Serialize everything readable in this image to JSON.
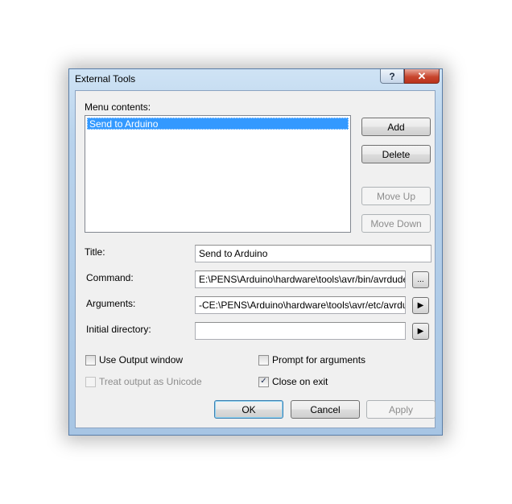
{
  "window": {
    "title": "External Tools",
    "help_label": "?",
    "close_label": "✕"
  },
  "menu": {
    "label": "Menu contents:",
    "items": [
      "Send to Arduino"
    ]
  },
  "buttons": {
    "add": "Add",
    "delete": "Delete",
    "move_up": "Move Up",
    "move_down": "Move Down",
    "ok": "OK",
    "cancel": "Cancel",
    "apply": "Apply"
  },
  "fields": {
    "title_label": "Title:",
    "title_value": "Send to Arduino",
    "command_label": "Command:",
    "command_value": "E:\\PENS\\Arduino\\hardware\\tools\\avr/bin/avrdude",
    "command_browse": "...",
    "arguments_label": "Arguments:",
    "arguments_value": "-CE:\\PENS\\Arduino\\hardware\\tools\\avr/etc/avrdude.conf",
    "arguments_arrow": "▶",
    "initial_dir_label": "Initial directory:",
    "initial_dir_value": "",
    "initial_dir_arrow": "▶"
  },
  "options": {
    "use_output_window": {
      "label": "Use Output window",
      "checked": false,
      "enabled": true
    },
    "prompt_for_arguments": {
      "label": "Prompt for arguments",
      "checked": false,
      "enabled": true
    },
    "treat_output_unicode": {
      "label": "Treat output as Unicode",
      "checked": false,
      "enabled": false
    },
    "close_on_exit": {
      "label": "Close on exit",
      "checked": true,
      "enabled": true
    }
  },
  "check_glyph": "✓",
  "colors": {
    "selection": "#3399ff",
    "frame": "#a7c5e4",
    "close_button": "#c8462e"
  }
}
